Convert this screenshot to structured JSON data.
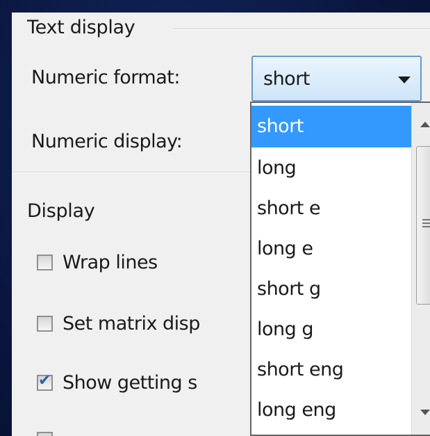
{
  "text_display": {
    "group_title": "Text display",
    "numeric_format_label": "Numeric format:",
    "numeric_format_value": "short",
    "numeric_display_label": "Numeric display:"
  },
  "display": {
    "group_title": "Display",
    "wrap_lines_label": "Wrap lines",
    "wrap_lines_checked": false,
    "matrix_label": "Set matrix disp",
    "matrix_checked": false,
    "getting_started_label": "Show getting s",
    "getting_started_checked": true
  },
  "format_dropdown": {
    "options": [
      "short",
      "long",
      "short e",
      "long e",
      "short g",
      "long g",
      "short eng",
      "long eng"
    ],
    "selected": "short"
  },
  "colors": {
    "selection": "#3399ff",
    "combo_border": "#6b98c9",
    "background": "#0b1a44"
  }
}
